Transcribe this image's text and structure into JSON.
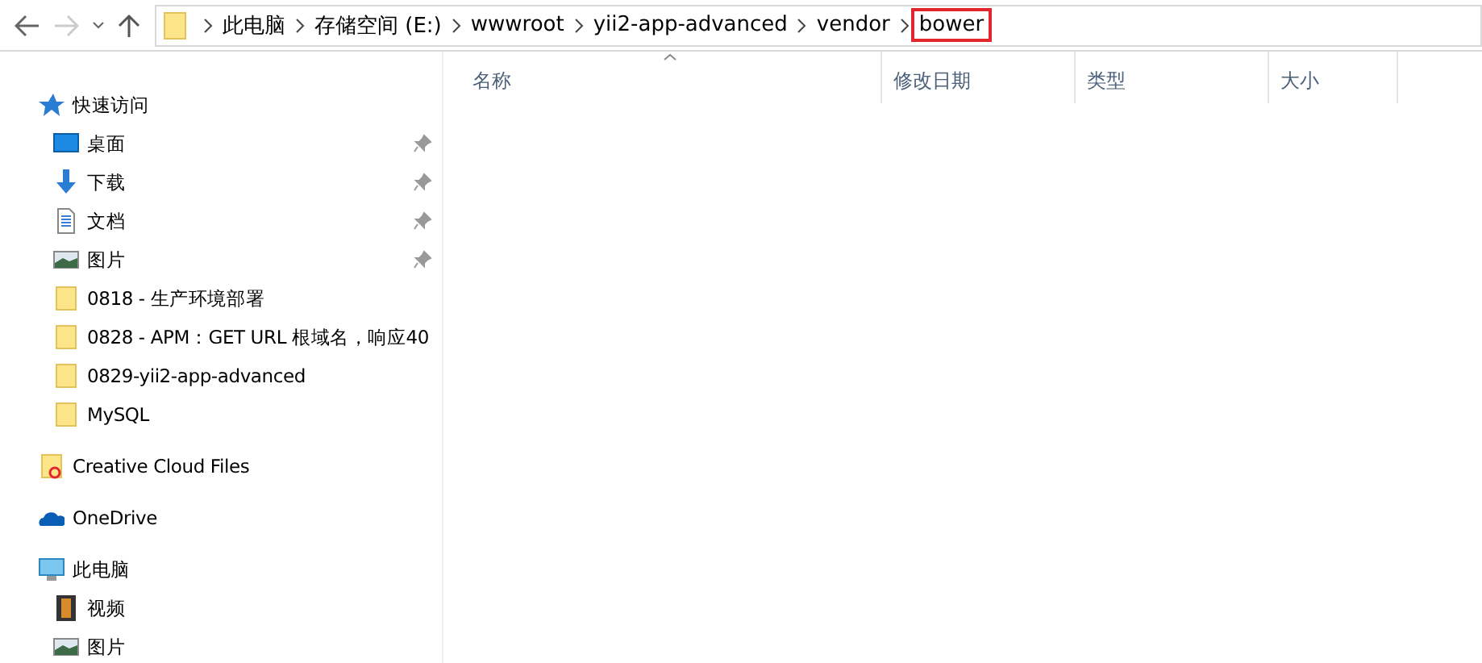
{
  "breadcrumb": [
    {
      "label": "此电脑",
      "highlighted": false
    },
    {
      "label": "存储空间 (E:)",
      "highlighted": false
    },
    {
      "label": "wwwroot",
      "highlighted": false
    },
    {
      "label": "yii2-app-advanced",
      "highlighted": false
    },
    {
      "label": "vendor",
      "highlighted": false
    },
    {
      "label": "bower",
      "highlighted": true
    }
  ],
  "nav": {
    "back_disabled": false,
    "forward_disabled": true
  },
  "columns": [
    {
      "label": "名称",
      "sorted": true
    },
    {
      "label": "修改日期",
      "sorted": false
    },
    {
      "label": "类型",
      "sorted": false
    },
    {
      "label": "大小",
      "sorted": false
    }
  ],
  "sidebar": [
    {
      "label": "快速访问",
      "kind": "star",
      "children": [
        {
          "label": "桌面",
          "kind": "desktop",
          "pinned": true
        },
        {
          "label": "下载",
          "kind": "download",
          "pinned": true
        },
        {
          "label": "文档",
          "kind": "document",
          "pinned": true
        },
        {
          "label": "图片",
          "kind": "image",
          "pinned": true
        },
        {
          "label": "0818 - 生产环境部署",
          "kind": "folder",
          "pinned": false
        },
        {
          "label": "0828 - APM：GET URL 根域名，响应40",
          "kind": "folder",
          "pinned": false
        },
        {
          "label": "0829-yii2-app-advanced",
          "kind": "folder",
          "pinned": false
        },
        {
          "label": "MySQL",
          "kind": "folder",
          "pinned": false
        }
      ]
    },
    {
      "label": "Creative Cloud Files",
      "kind": "cloudfolder"
    },
    {
      "label": "OneDrive",
      "kind": "cloud"
    },
    {
      "label": "此电脑",
      "kind": "computer",
      "children": [
        {
          "label": "视频",
          "kind": "video",
          "pinned": false
        },
        {
          "label": "图片",
          "kind": "image",
          "pinned": false
        }
      ]
    }
  ]
}
